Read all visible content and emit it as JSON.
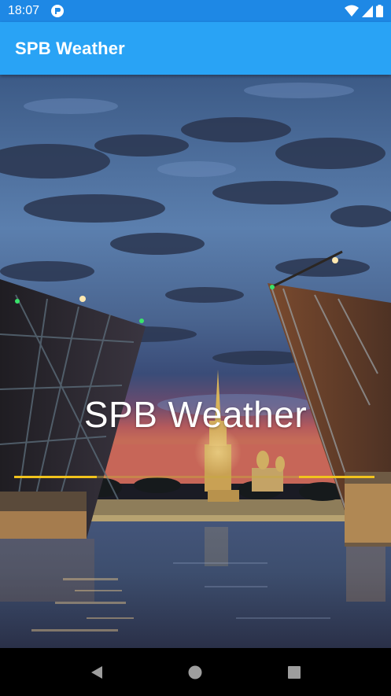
{
  "status_bar": {
    "time": "18:07",
    "icons": [
      "app-notification-icon",
      "wifi-icon",
      "cell-signal-icon",
      "battery-icon"
    ]
  },
  "app_bar": {
    "title": "SPB Weather",
    "color": "#29a3f5"
  },
  "splash": {
    "title": "SPB Weather",
    "progress_color": "#f1c31d",
    "progress_segments": [
      {
        "start": 0.0,
        "end": 0.23
      },
      {
        "start": 0.79,
        "end": 1.0
      }
    ]
  },
  "nav_bar": {
    "buttons": [
      "back-icon",
      "home-icon",
      "recents-icon"
    ]
  }
}
